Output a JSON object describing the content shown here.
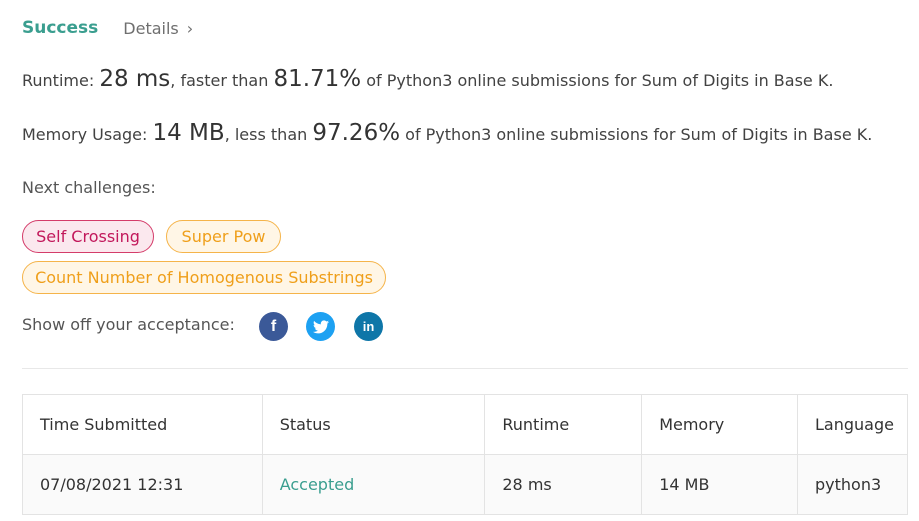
{
  "header": {
    "status": "Success",
    "details_label": "Details"
  },
  "runtime": {
    "label": "Runtime: ",
    "value": "28 ms",
    "comparison": ", faster than ",
    "percent": "81.71%",
    "suffix": " of Python3 online submissions for Sum of Digits in Base K."
  },
  "memory": {
    "label": "Memory Usage: ",
    "value": "14 MB",
    "comparison": ", less than ",
    "percent": "97.26%",
    "suffix": " of Python3 online submissions for Sum of Digits in Base K."
  },
  "next_challenges": {
    "label": "Next challenges:",
    "items": [
      {
        "label": "Self Crossing",
        "difficulty": "hard",
        "color": "#c2185b"
      },
      {
        "label": "Super Pow",
        "difficulty": "medium",
        "color": "#ef9f1a"
      },
      {
        "label": "Count Number of Homogenous Substrings",
        "difficulty": "medium",
        "color": "#ef9f1a"
      }
    ]
  },
  "share": {
    "label": "Show off your acceptance:",
    "icons": [
      "facebook-icon",
      "twitter-icon",
      "linkedin-icon"
    ]
  },
  "table": {
    "headers": [
      "Time Submitted",
      "Status",
      "Runtime",
      "Memory",
      "Language"
    ],
    "rows": [
      [
        "07/08/2021 12:31",
        "Accepted",
        "28 ms",
        "14 MB",
        "python3"
      ]
    ]
  },
  "colors": {
    "accent": "#3a9e8f",
    "hard": "#c2185b",
    "medium": "#ef9f1a"
  }
}
